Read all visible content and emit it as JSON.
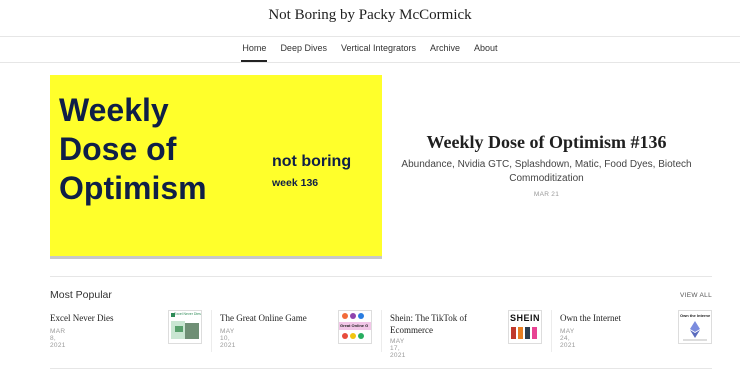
{
  "site": {
    "title": "Not Boring by Packy McCormick"
  },
  "nav": {
    "items": [
      {
        "label": "Home",
        "active": true
      },
      {
        "label": "Deep Dives"
      },
      {
        "label": "Vertical Integrators"
      },
      {
        "label": "Archive"
      },
      {
        "label": "About"
      }
    ]
  },
  "hero": {
    "image_text": {
      "line1": "Weekly",
      "line2": "Dose of",
      "line3": "Optimism",
      "brand": "not boring",
      "week": "week 136"
    },
    "image_bg_color": "#ffff2b",
    "image_text_color": "#0f1f47",
    "title": "Weekly Dose of Optimism #136",
    "subtitle": "Abundance, Nvidia GTC, Splashdown, Matic, Food Dyes, Biotech Commoditization",
    "date": "MAR 21"
  },
  "popular": {
    "heading": "Most Popular",
    "view_all": "VIEW ALL",
    "items": [
      {
        "title": "Excel Never Dies",
        "date": "MAR 8, 2021",
        "thumb_text": "Excel Never Dies",
        "thumb_icon": "excel-thumbnail"
      },
      {
        "title": "The Great Online Game",
        "date": "MAY 10, 2021",
        "thumb_text": "Great Online G",
        "thumb_icon": "game-thumbnail"
      },
      {
        "title": "Shein: The TikTok of Ecommerce",
        "date": "MAY 17, 2021",
        "thumb_text": "SHEIN",
        "thumb_icon": "shein-thumbnail"
      },
      {
        "title": "Own the Internet",
        "date": "MAY 24, 2021",
        "thumb_text": "Own the Interne",
        "thumb_icon": "internet-thumbnail"
      }
    ]
  }
}
